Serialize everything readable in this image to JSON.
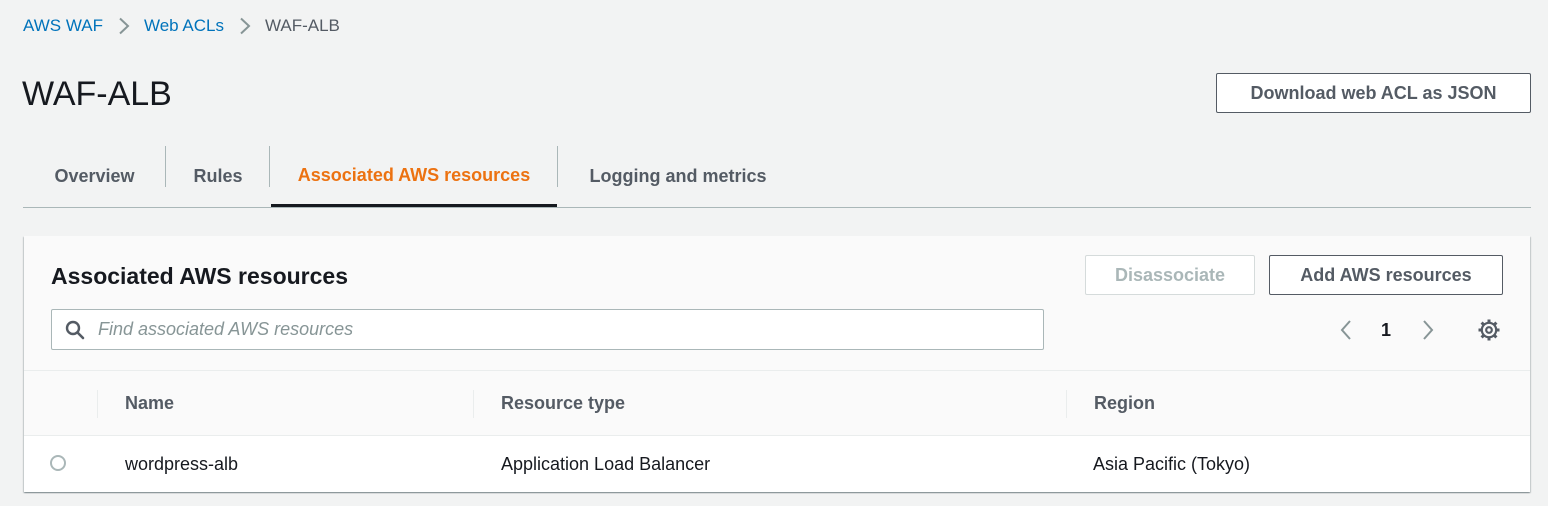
{
  "breadcrumb": {
    "items": [
      {
        "label": "AWS WAF"
      },
      {
        "label": "Web ACLs"
      }
    ],
    "current": "WAF-ALB"
  },
  "page": {
    "title": "WAF-ALB",
    "download_label": "Download web ACL as JSON"
  },
  "tabs": [
    {
      "label": "Overview",
      "active": false
    },
    {
      "label": "Rules",
      "active": false
    },
    {
      "label": "Associated AWS resources",
      "active": true
    },
    {
      "label": "Logging and metrics",
      "active": false
    }
  ],
  "panel": {
    "title": "Associated AWS resources",
    "disassociate_label": "Disassociate",
    "add_label": "Add AWS resources",
    "search": {
      "placeholder": "Find associated AWS resources",
      "value": ""
    },
    "pagination": {
      "current_page": "1"
    },
    "table": {
      "columns": [
        "Name",
        "Resource type",
        "Region"
      ],
      "rows": [
        {
          "name": "wordpress-alb",
          "resource_type": "Application Load Balancer",
          "region": "Asia Pacific (Tokyo)",
          "selected": false
        }
      ]
    }
  },
  "colors": {
    "link": "#0073bb",
    "active_tab": "#ec7211",
    "text": "#16191f",
    "secondary_text": "#545b64",
    "background": "#f2f3f3"
  },
  "icons": [
    "chevron-right-icon",
    "search-icon",
    "chevron-left-icon",
    "gear-icon"
  ]
}
